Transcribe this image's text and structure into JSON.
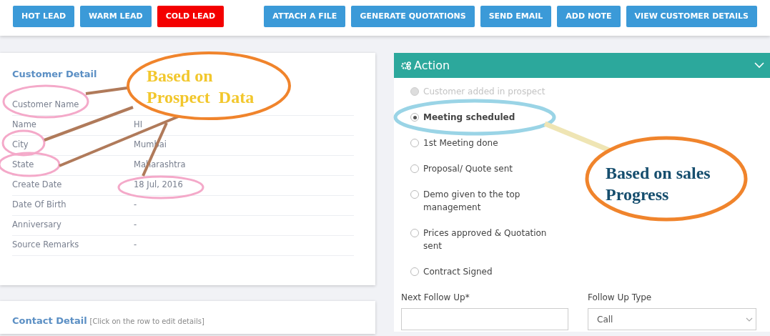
{
  "toolbar": {
    "left_buttons": [
      {
        "label": "HOT LEAD",
        "kind": "primary"
      },
      {
        "label": "WARM LEAD",
        "kind": "primary"
      },
      {
        "label": "COLD LEAD",
        "kind": "danger"
      }
    ],
    "right_buttons": [
      {
        "label": "ATTACH A FILE",
        "kind": "primary"
      },
      {
        "label": "GENERATE QUOTATIONS",
        "kind": "primary"
      },
      {
        "label": "SEND EMAIL",
        "kind": "primary"
      },
      {
        "label": "ADD NOTE",
        "kind": "primary"
      },
      {
        "label": "VIEW CUSTOMER DETAILS",
        "kind": "primary"
      }
    ]
  },
  "customer_detail": {
    "title": "Customer Detail",
    "section_label": "Customer Name",
    "rows": [
      {
        "label": "Name",
        "value": "HI"
      },
      {
        "label": "City",
        "value": "Mumbai"
      },
      {
        "label": "State",
        "value": "Maharashtra"
      },
      {
        "label": "Create Date",
        "value": "18 Jul, 2016"
      },
      {
        "label": "Date Of Birth",
        "value": "-"
      },
      {
        "label": "Anniversary",
        "value": "-"
      },
      {
        "label": "Source Remarks",
        "value": "-"
      }
    ]
  },
  "contact_detail": {
    "title": "Contact Detail",
    "note": "[Click on the row to edit details]"
  },
  "action": {
    "title": "Action",
    "expanded": true,
    "options": [
      {
        "label": "Customer added in prospect",
        "selected": false,
        "disabled": true
      },
      {
        "label": "Meeting scheduled",
        "selected": true,
        "disabled": false
      },
      {
        "label": "1st Meeting done",
        "selected": false,
        "disabled": false
      },
      {
        "label": "Proposal/ Quote sent",
        "selected": false,
        "disabled": false
      },
      {
        "label": "Demo given to the top management",
        "selected": false,
        "disabled": false
      },
      {
        "label": "Prices approved & Quotation sent",
        "selected": false,
        "disabled": false
      },
      {
        "label": "Contract Signed",
        "selected": false,
        "disabled": false
      }
    ],
    "fields": [
      {
        "kind": "input",
        "label": "Next Follow Up*"
      },
      {
        "kind": "select",
        "label": "Follow Up Type",
        "value": "Call"
      }
    ]
  },
  "annotations": [
    {
      "lines": [
        "Based on",
        "Prospect  Data"
      ],
      "color": "#f2c72c"
    },
    {
      "lines": [
        "Based on sales",
        "Progress"
      ],
      "color": "#164e6e"
    }
  ]
}
